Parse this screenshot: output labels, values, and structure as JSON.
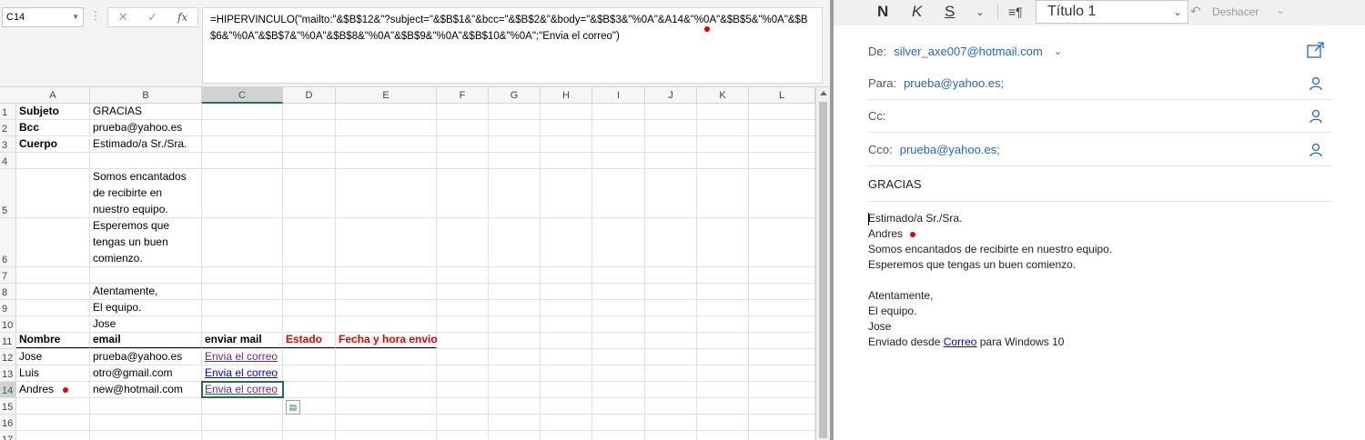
{
  "excel": {
    "name_box": "C14",
    "formula": "=HIPERVINCULO(\"mailto:\"&$B$12&\"?subject=\"&$B$1&\"&bcc=\"&$B$2&\"&body=\"&$B$3&\"%0A\"&A14&\"%0A\"&$B$5&\"%0A\"&$B$6&\"%0A\"&$B$7&\"%0A\"&$B$8&\"%0A\"&$B$9&\"%0A\"&$B$10&\"%0A\";\"Envia el correo\")",
    "columns": [
      "A",
      "B",
      "C",
      "D",
      "E",
      "F",
      "G",
      "H",
      "I",
      "J",
      "K",
      "L"
    ],
    "selected_column": "C",
    "rows": [
      {
        "n": "1",
        "cells": {
          "A": "Subjeto",
          "B": "GRACIAS"
        }
      },
      {
        "n": "2",
        "cells": {
          "A": "Bcc",
          "B": "prueba@yahoo.es"
        }
      },
      {
        "n": "3",
        "cells": {
          "A": "Cuerpo",
          "B": "Estimado/a Sr./Sra."
        }
      },
      {
        "n": "4",
        "cells": {}
      },
      {
        "n": "5",
        "cells": {
          "B": [
            "Somos encantados",
            "de recibirte en",
            "nuestro equipo."
          ]
        }
      },
      {
        "n": "6",
        "cells": {
          "B": [
            "Esperemos que",
            "tengas un buen",
            "comienzo."
          ]
        }
      },
      {
        "n": "7",
        "cells": {}
      },
      {
        "n": "8",
        "cells": {
          "B": "Atentamente,"
        }
      },
      {
        "n": "9",
        "cells": {
          "B": "El equipo."
        }
      },
      {
        "n": "10",
        "cells": {
          "B": "Jose"
        }
      },
      {
        "n": "11",
        "cells": {
          "A": "Nombre",
          "B": "email",
          "C": "enviar mail",
          "D": "Estado",
          "E": "Fecha y hora envio"
        }
      },
      {
        "n": "12",
        "cells": {
          "A": "Jose",
          "B": "prueba@yahoo.es",
          "C": "Envia el correo"
        }
      },
      {
        "n": "13",
        "cells": {
          "A": "Luis",
          "B": "otro@gmail.com",
          "C": "Envia el correo"
        }
      },
      {
        "n": "14",
        "cells": {
          "A": "Andres",
          "B": "new@hotmail.com",
          "C": "Envia el correo"
        }
      },
      {
        "n": "15",
        "cells": {}
      },
      {
        "n": "16",
        "cells": {}
      },
      {
        "n": "17",
        "cells": {}
      }
    ],
    "colors": {
      "accent": "#217346",
      "header_red": "#e60000",
      "link": "#0000ee",
      "visited": "#7a1f9a"
    }
  },
  "mail": {
    "toolbar": {
      "bold": "N",
      "italic": "K",
      "underline": "S",
      "style": "Título 1",
      "undo": "Deshacer"
    },
    "from_label": "De:",
    "from_value": "silver_axe007@hotmail.com",
    "to_label": "Para:",
    "to_value": "prueba@yahoo.es;",
    "cc_label": "Cc:",
    "cc_value": "",
    "bcc_label": "Cco:",
    "bcc_value": "prueba@yahoo.es;",
    "subject": "GRACIAS",
    "body": {
      "l1": "Estimado/a Sr./Sra.",
      "l2": "Andres",
      "l3": "Somos encantados de recibirte en nuestro equipo.",
      "l4": "Esperemos que tengas un buen comienzo.",
      "l5": "Atentamente,",
      "l6": "El equipo.",
      "l7": "Jose",
      "sig_pre": "Enviado desde ",
      "sig_link": "Correo",
      "sig_post": " para Windows 10"
    }
  }
}
